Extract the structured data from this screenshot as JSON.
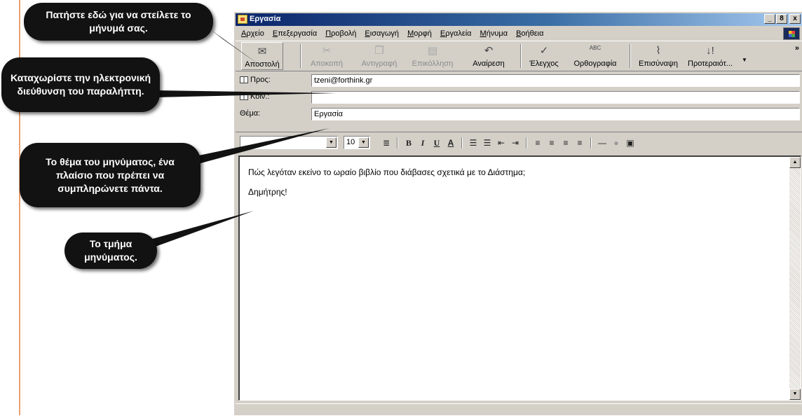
{
  "window": {
    "title": "Εργασία",
    "controls": [
      "_",
      "8",
      "x"
    ]
  },
  "menu": [
    "Αρχείο",
    "Επεξεργασία",
    "Προβολή",
    "Εισαγωγή",
    "Μορφή",
    "Εργαλεία",
    "Μήνυμα",
    "Βοήθεια"
  ],
  "toolbar": {
    "send": "Αποστολή",
    "cut": "Αποκοπή",
    "copy": "Αντιγραφή",
    "paste": "Επικόλληση",
    "undo": "Αναίρεση",
    "check": "Έλεγχος",
    "spelling": "Ορθογραφία",
    "attach": "Επισύναψη",
    "priority": "Προτεραιότ...",
    "spell_icon_text": "ABC"
  },
  "header": {
    "to_label": "Προς:",
    "to_value": "tzeni@forthink.gr",
    "cc_label": "Κοιν.:",
    "cc_value": "",
    "subject_label": "Θέμα:",
    "subject_value": "Εργασία"
  },
  "format": {
    "font_size": "10",
    "bold": "B",
    "italic": "I",
    "underline": "U",
    "font_color": "A"
  },
  "body": {
    "line1": "Πώς λεγόταν εκείνο το ωραίο βιβλίο που διάβασες σχετικά με το Διάστημα;",
    "line2": "Δημήτρης!"
  },
  "callouts": {
    "send": "Πατήστε εδώ για να στείλετε το μήνυμά σας.",
    "recipient": "Καταχωρίστε την ηλεκτρονική διεύθυνση του παραλήπτη.",
    "subject": "Το θέμα του μηνύματος, ένα πλαίσιο που πρέπει να συμπληρώνετε πάντα.",
    "body": "Το τμήμα μηνύματος."
  },
  "colors": {
    "title_gradient_start": "#0a246a",
    "title_gradient_end": "#a6caf0",
    "chrome": "#d4d0c8",
    "callout_bg": "#121212",
    "page_rule": "#e9a070"
  }
}
